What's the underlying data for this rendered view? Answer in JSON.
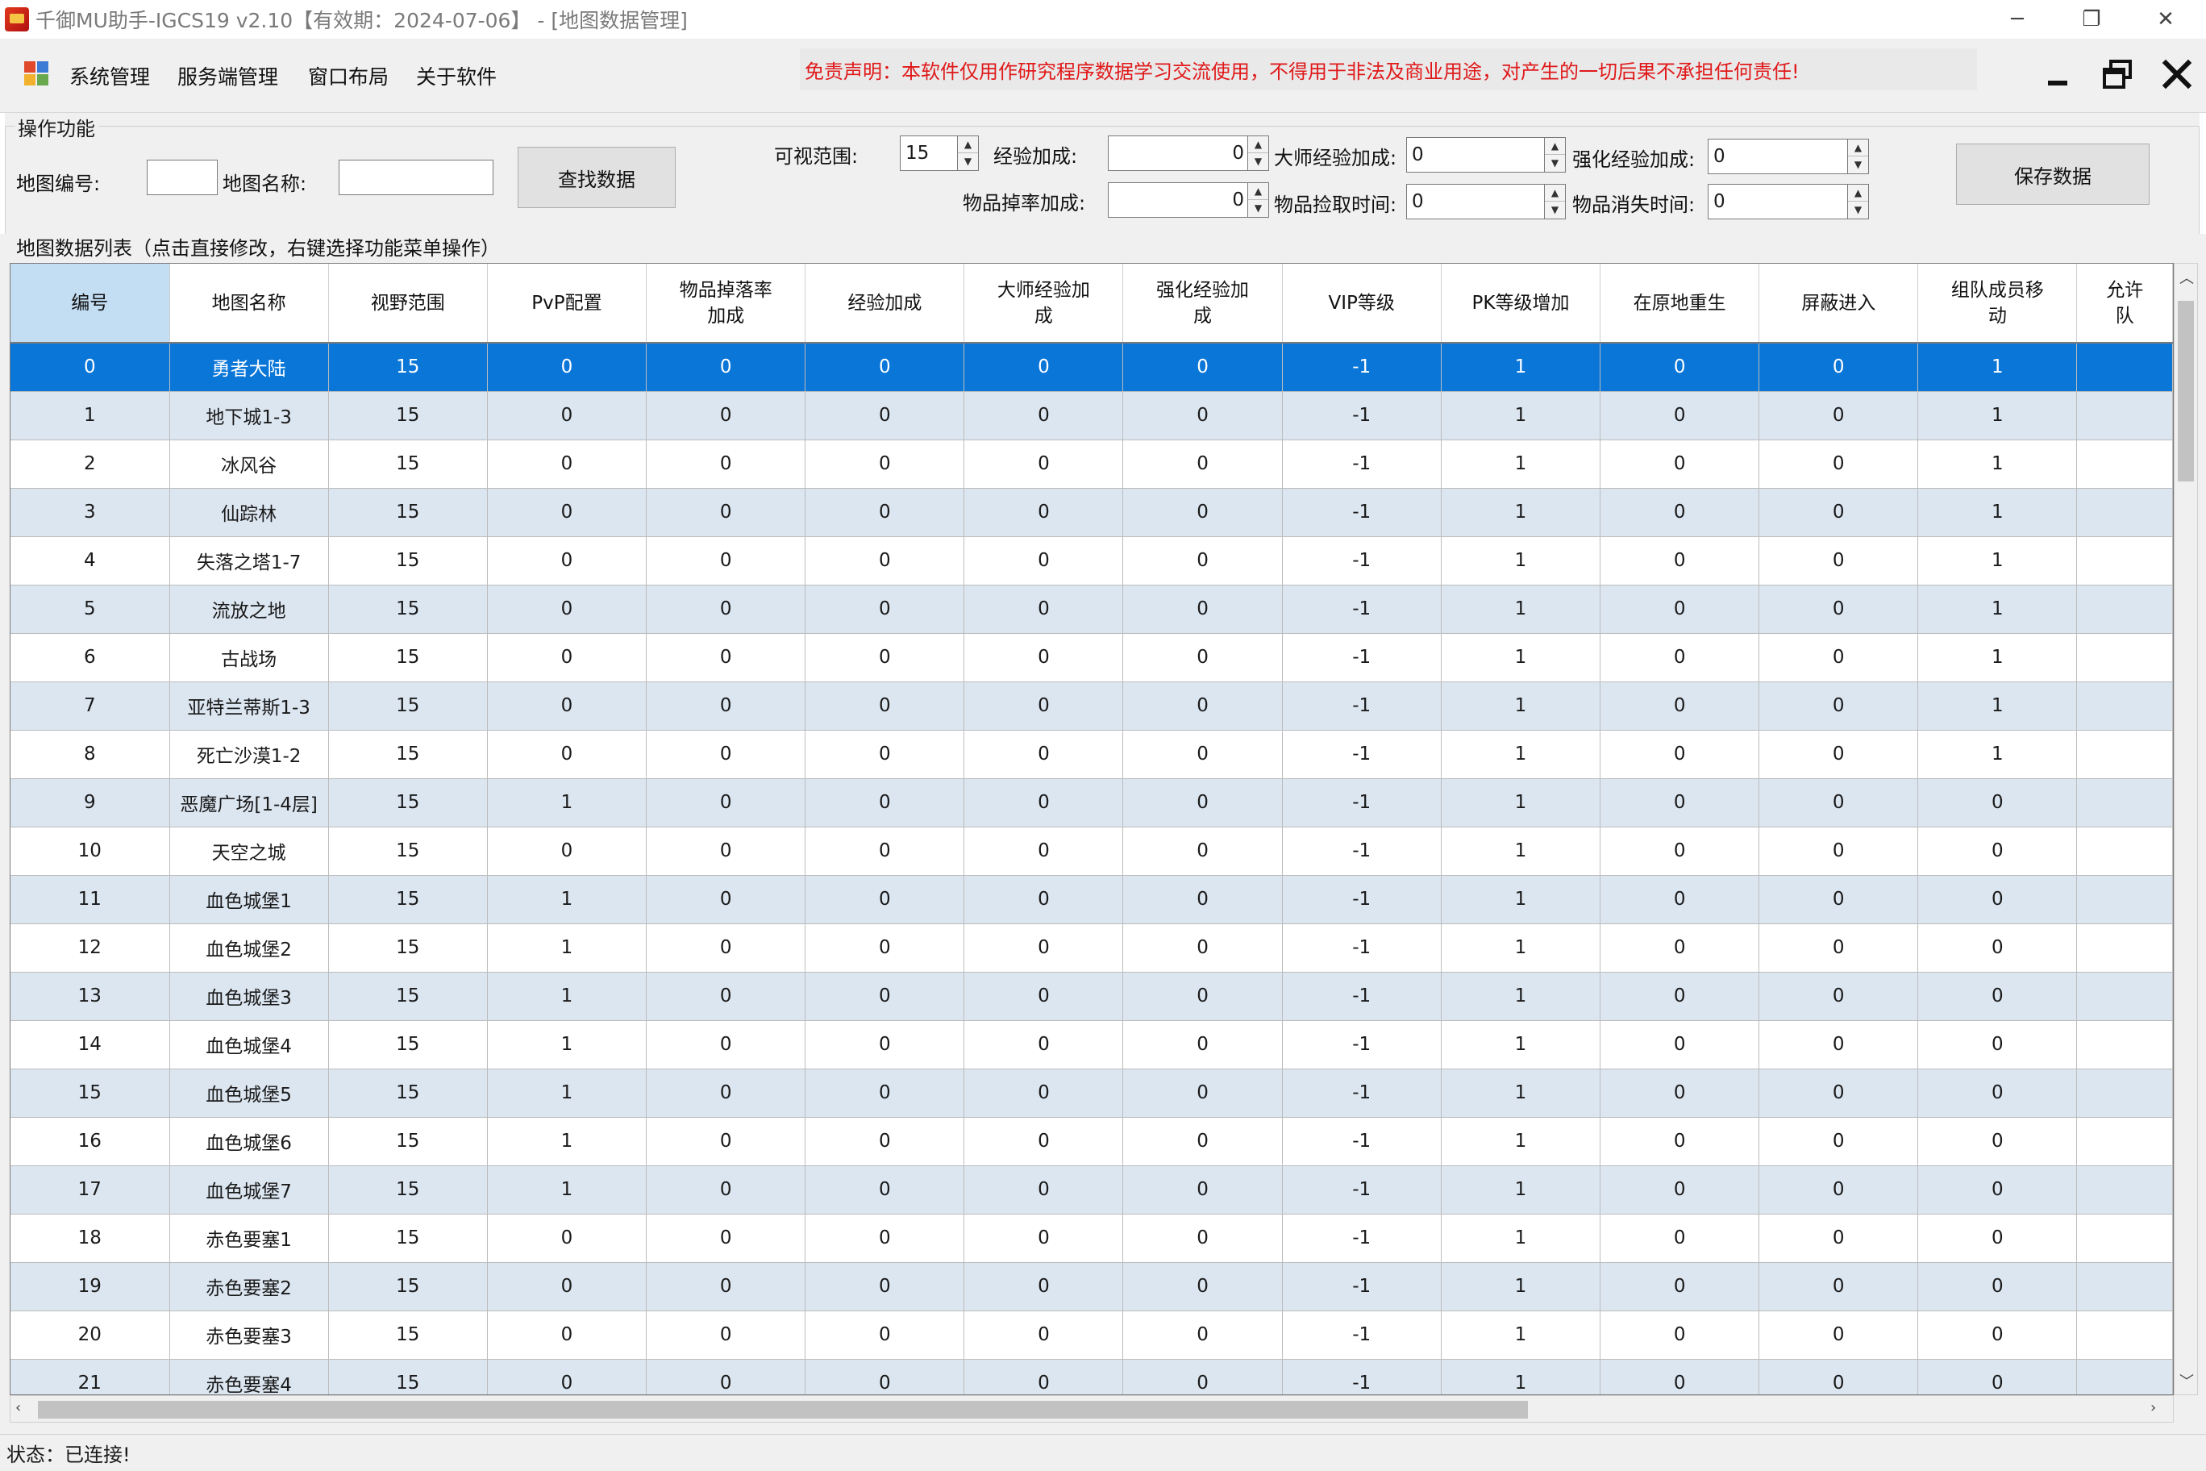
{
  "window": {
    "title": "千御MU助手-IGCS19 v2.10【有效期：2024-07-06】 - [地图数据管理]",
    "min_glyph": "─",
    "restore_glyph": "❐",
    "close_glyph": "✕"
  },
  "menu": {
    "items": [
      "系统管理",
      "服务端管理",
      "窗口布局",
      "关于软件"
    ],
    "disclaimer": "免责声明：本软件仅用作研究程序数据学习交流使用，不得用于非法及商业用途，对产生的一切后果不承担任何责任!"
  },
  "ops": {
    "group_title": "操作功能",
    "map_id_label": "地图编号:",
    "map_id_value": "",
    "map_name_label": "地图名称:",
    "map_name_value": "",
    "search_button": "查找数据",
    "view_range_label": "可视范围:",
    "view_range_value": "15",
    "exp_bonus_label": "经验加成:",
    "exp_bonus_value": "0",
    "master_exp_label": "大师经验加成:",
    "master_exp_value": "0",
    "enhance_exp_label": "强化经验加成:",
    "enhance_exp_value": "0",
    "drop_rate_label": "物品掉率加成:",
    "drop_rate_value": "0",
    "pickup_time_label": "物品捡取时间:",
    "pickup_time_value": "0",
    "vanish_time_label": "物品消失时间:",
    "vanish_time_value": "0",
    "save_button": "保存数据"
  },
  "grid": {
    "caption": "地图数据列表（点击直接修改，右键选择功能菜单操作）",
    "columns": [
      "编号",
      "地图名称",
      "视野范围",
      "PvP配置",
      "物品掉落率\n加成",
      "经验加成",
      "大师经验加\n成",
      "强化经验加\n成",
      "VIP等级",
      "PK等级增加",
      "在原地重生",
      "屏蔽进入",
      "组队成员移\n动",
      "允许\n队"
    ],
    "rows": [
      [
        "0",
        "勇者大陆",
        "15",
        "0",
        "0",
        "0",
        "0",
        "0",
        "-1",
        "1",
        "0",
        "0",
        "1",
        ""
      ],
      [
        "1",
        "地下城1-3",
        "15",
        "0",
        "0",
        "0",
        "0",
        "0",
        "-1",
        "1",
        "0",
        "0",
        "1",
        ""
      ],
      [
        "2",
        "冰风谷",
        "15",
        "0",
        "0",
        "0",
        "0",
        "0",
        "-1",
        "1",
        "0",
        "0",
        "1",
        ""
      ],
      [
        "3",
        "仙踪林",
        "15",
        "0",
        "0",
        "0",
        "0",
        "0",
        "-1",
        "1",
        "0",
        "0",
        "1",
        ""
      ],
      [
        "4",
        "失落之塔1-7",
        "15",
        "0",
        "0",
        "0",
        "0",
        "0",
        "-1",
        "1",
        "0",
        "0",
        "1",
        ""
      ],
      [
        "5",
        "流放之地",
        "15",
        "0",
        "0",
        "0",
        "0",
        "0",
        "-1",
        "1",
        "0",
        "0",
        "1",
        ""
      ],
      [
        "6",
        "古战场",
        "15",
        "0",
        "0",
        "0",
        "0",
        "0",
        "-1",
        "1",
        "0",
        "0",
        "1",
        ""
      ],
      [
        "7",
        "亚特兰蒂斯1-3",
        "15",
        "0",
        "0",
        "0",
        "0",
        "0",
        "-1",
        "1",
        "0",
        "0",
        "1",
        ""
      ],
      [
        "8",
        "死亡沙漠1-2",
        "15",
        "0",
        "0",
        "0",
        "0",
        "0",
        "-1",
        "1",
        "0",
        "0",
        "1",
        ""
      ],
      [
        "9",
        "恶魔广场[1-4层]",
        "15",
        "1",
        "0",
        "0",
        "0",
        "0",
        "-1",
        "1",
        "0",
        "0",
        "0",
        ""
      ],
      [
        "10",
        "天空之城",
        "15",
        "0",
        "0",
        "0",
        "0",
        "0",
        "-1",
        "1",
        "0",
        "0",
        "0",
        ""
      ],
      [
        "11",
        "血色城堡1",
        "15",
        "1",
        "0",
        "0",
        "0",
        "0",
        "-1",
        "1",
        "0",
        "0",
        "0",
        ""
      ],
      [
        "12",
        "血色城堡2",
        "15",
        "1",
        "0",
        "0",
        "0",
        "0",
        "-1",
        "1",
        "0",
        "0",
        "0",
        ""
      ],
      [
        "13",
        "血色城堡3",
        "15",
        "1",
        "0",
        "0",
        "0",
        "0",
        "-1",
        "1",
        "0",
        "0",
        "0",
        ""
      ],
      [
        "14",
        "血色城堡4",
        "15",
        "1",
        "0",
        "0",
        "0",
        "0",
        "-1",
        "1",
        "0",
        "0",
        "0",
        ""
      ],
      [
        "15",
        "血色城堡5",
        "15",
        "1",
        "0",
        "0",
        "0",
        "0",
        "-1",
        "1",
        "0",
        "0",
        "0",
        ""
      ],
      [
        "16",
        "血色城堡6",
        "15",
        "1",
        "0",
        "0",
        "0",
        "0",
        "-1",
        "1",
        "0",
        "0",
        "0",
        ""
      ],
      [
        "17",
        "血色城堡7",
        "15",
        "1",
        "0",
        "0",
        "0",
        "0",
        "-1",
        "1",
        "0",
        "0",
        "0",
        ""
      ],
      [
        "18",
        "赤色要塞1",
        "15",
        "0",
        "0",
        "0",
        "0",
        "0",
        "-1",
        "1",
        "0",
        "0",
        "0",
        ""
      ],
      [
        "19",
        "赤色要塞2",
        "15",
        "0",
        "0",
        "0",
        "0",
        "0",
        "-1",
        "1",
        "0",
        "0",
        "0",
        ""
      ],
      [
        "20",
        "赤色要塞3",
        "15",
        "0",
        "0",
        "0",
        "0",
        "0",
        "-1",
        "1",
        "0",
        "0",
        "0",
        ""
      ],
      [
        "21",
        "赤色要塞4",
        "15",
        "0",
        "0",
        "0",
        "0",
        "0",
        "-1",
        "1",
        "0",
        "0",
        "0",
        ""
      ]
    ],
    "selected_row": 0
  },
  "status": {
    "text": "状态：已连接!"
  },
  "colors": {
    "selected_row": "#0a76d8",
    "alt_row": "#dce6f1",
    "header_highlight": "#c3ddf3",
    "disclaimer_text": "#e0191a"
  }
}
